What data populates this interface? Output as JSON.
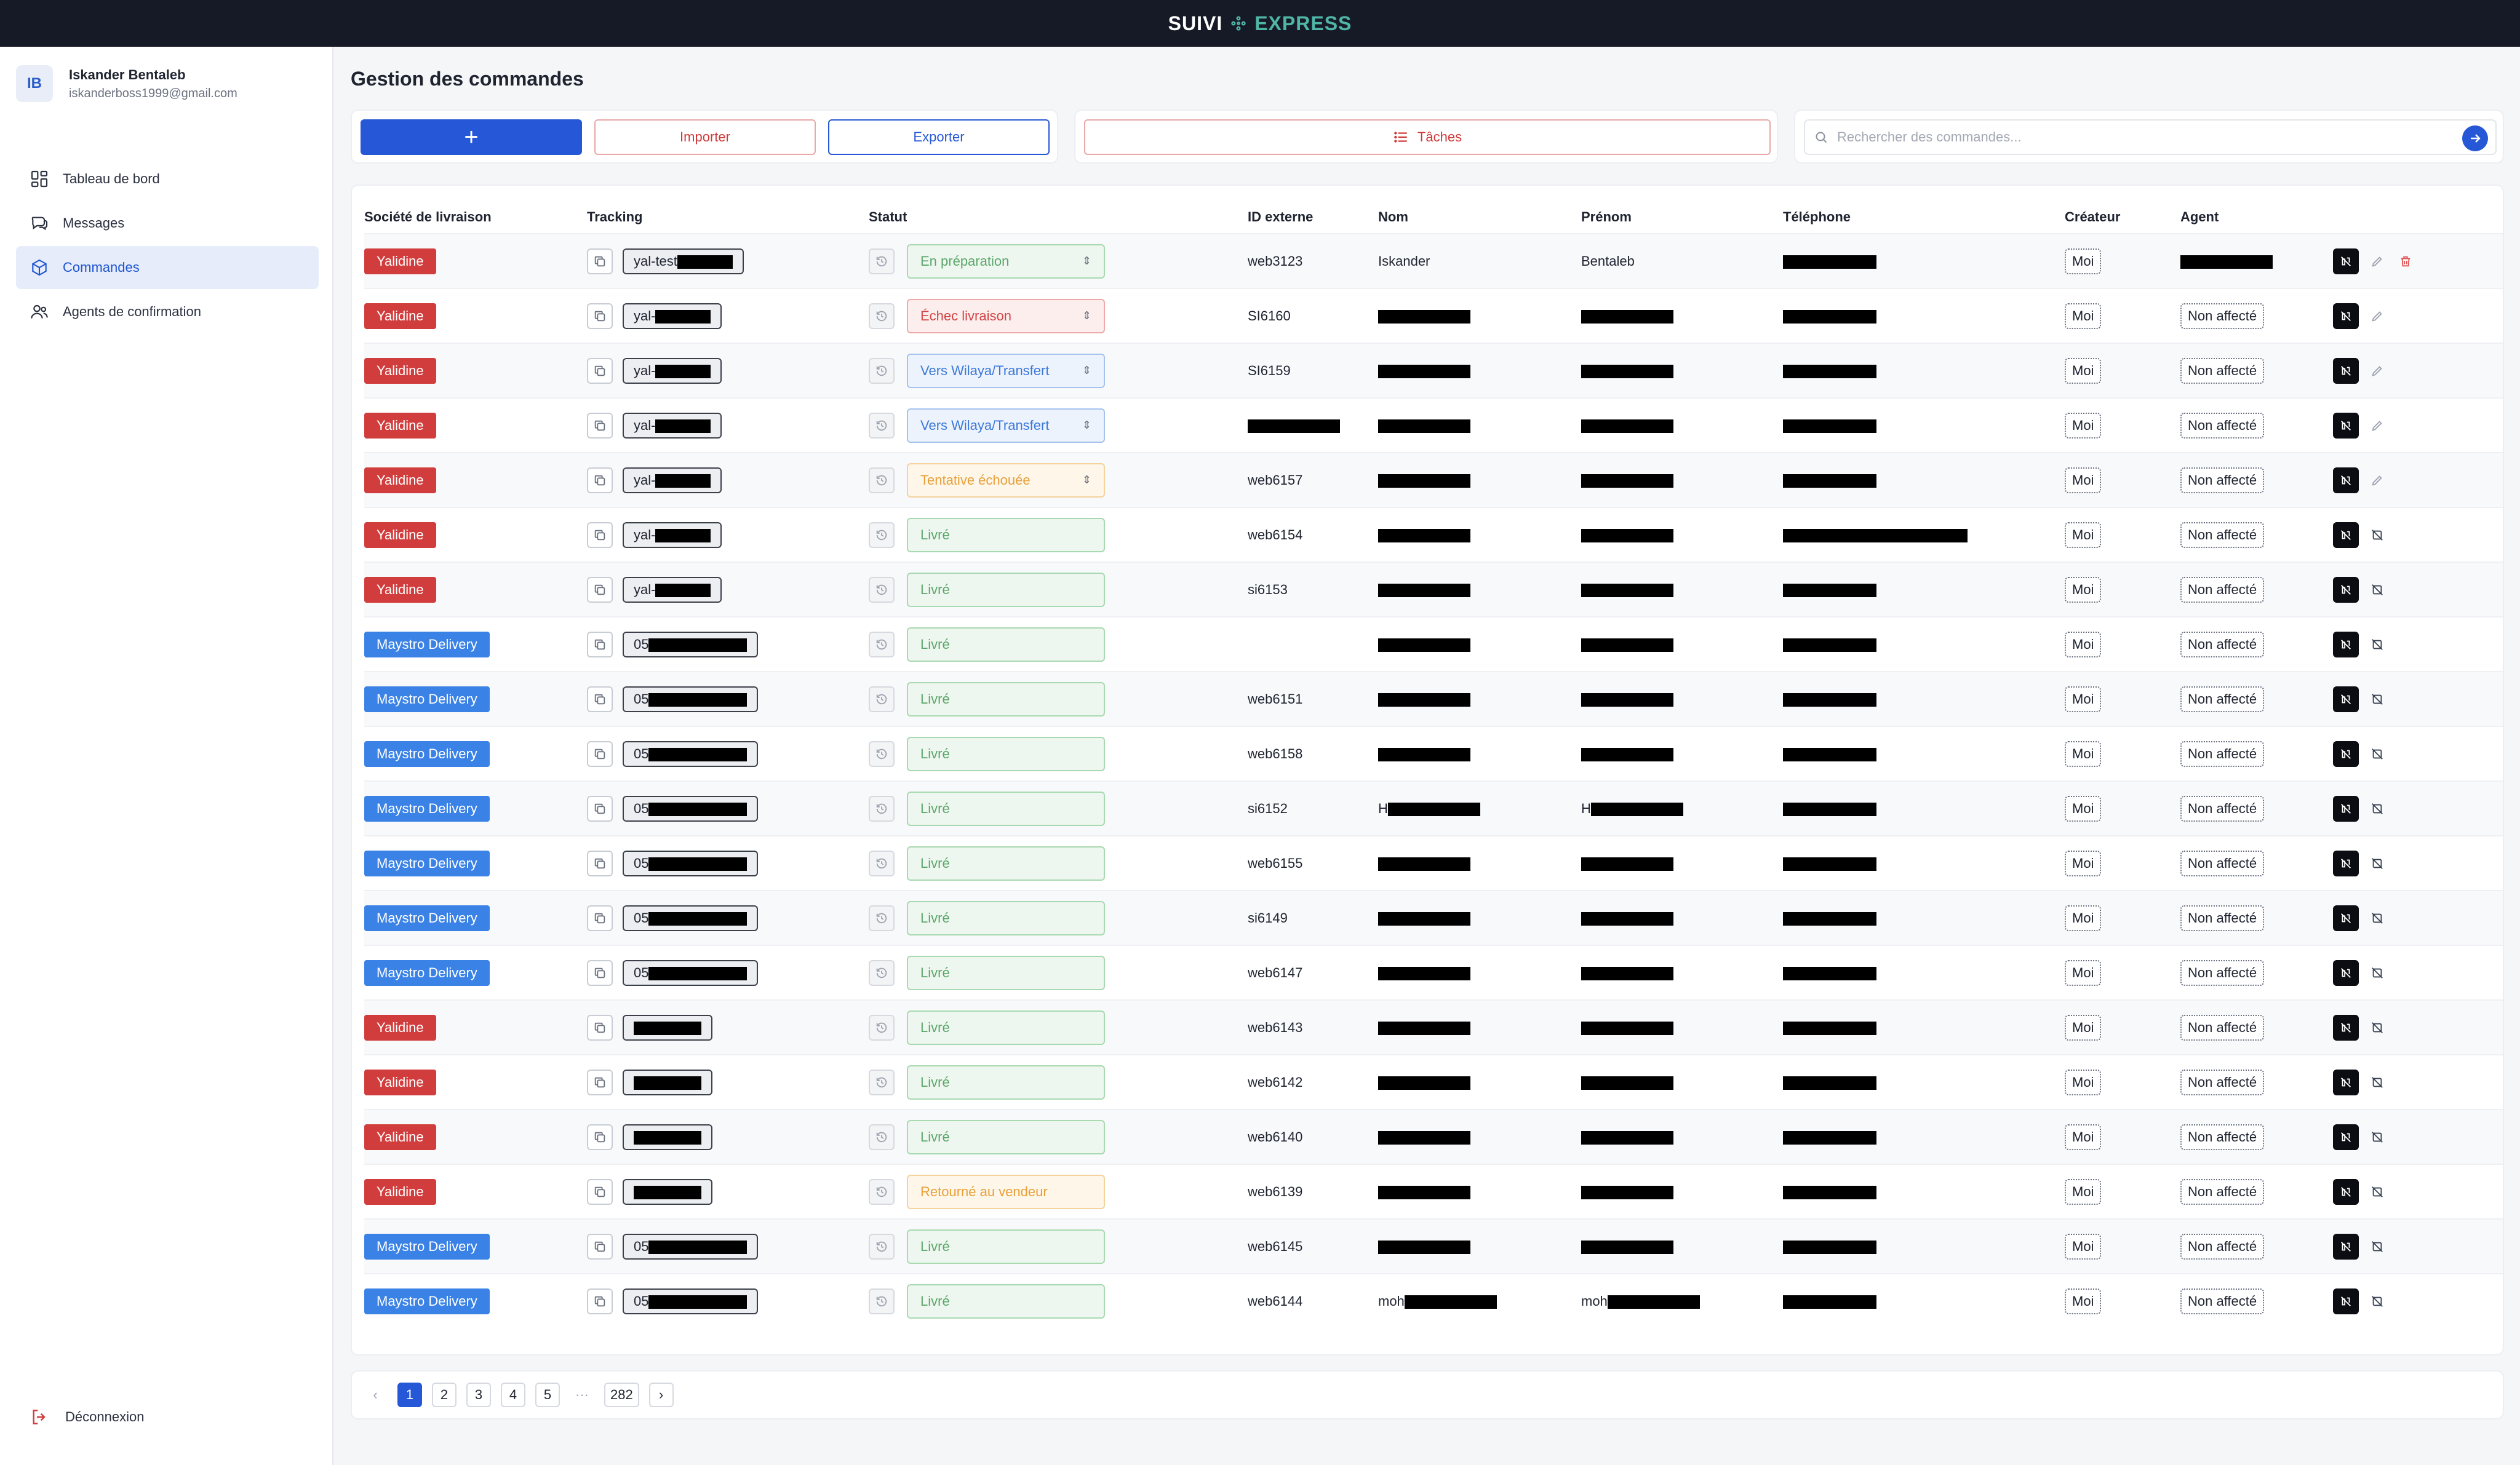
{
  "brand": {
    "part1": "SUIVI",
    "part2": "EXPRESS"
  },
  "user": {
    "initials": "IB",
    "name": "Iskander Bentaleb",
    "email": "iskanderboss1999@gmail.com"
  },
  "nav": [
    {
      "label": "Tableau de bord",
      "icon": "dashboard-icon",
      "active": false
    },
    {
      "label": "Messages",
      "icon": "messages-icon",
      "active": false
    },
    {
      "label": "Commandes",
      "icon": "box-icon",
      "active": true
    },
    {
      "label": "Agents de confirmation",
      "icon": "users-icon",
      "active": false
    }
  ],
  "logout_label": "Déconnexion",
  "page_title": "Gestion des commandes",
  "toolbar": {
    "add_label": "+",
    "import_label": "Importer",
    "export_label": "Exporter",
    "tasks_label": "Tâches",
    "search_placeholder": "Rechercher des commandes..."
  },
  "columns": [
    "Société de livraison",
    "Tracking",
    "Statut",
    "ID externe",
    "Nom",
    "Prénom",
    "Téléphone",
    "Créateur",
    "Agent"
  ],
  "rows": [
    {
      "company": "Yalidine",
      "tracking": "yal-test",
      "status": "En préparation",
      "status_tone": "green",
      "ext_id": "web3123",
      "nom": "Iskander",
      "prenom": "Bentaleb",
      "creator": "Moi",
      "agent": "",
      "actions": "edit-delete"
    },
    {
      "company": "Yalidine",
      "tracking": "yal-",
      "status": "Échec livraison",
      "status_tone": "red",
      "ext_id": "SI6160",
      "nom": "",
      "prenom": "",
      "creator": "Moi",
      "agent": "Non affecté",
      "actions": "edit"
    },
    {
      "company": "Yalidine",
      "tracking": "yal-",
      "status": "Vers Wilaya/Transfert",
      "status_tone": "blue",
      "ext_id": "SI6159",
      "nom": "",
      "prenom": "",
      "creator": "Moi",
      "agent": "Non affecté",
      "actions": "edit"
    },
    {
      "company": "Yalidine",
      "tracking": "yal-",
      "status": "Vers Wilaya/Transfert",
      "status_tone": "blue",
      "ext_id": "",
      "nom": "",
      "prenom": "",
      "creator": "Moi",
      "agent": "Non affecté",
      "actions": "edit"
    },
    {
      "company": "Yalidine",
      "tracking": "yal-",
      "status": "Tentative échouée",
      "status_tone": "orange",
      "ext_id": "web6157",
      "nom": "",
      "prenom": "",
      "creator": "Moi",
      "agent": "Non affecté",
      "actions": "edit"
    },
    {
      "company": "Yalidine",
      "tracking": "yal-",
      "status": "Livré",
      "status_tone": "green",
      "ext_id": "web6154",
      "nom": "",
      "prenom": "",
      "creator": "Moi",
      "agent": "Non affecté",
      "actions": "cancel"
    },
    {
      "company": "Yalidine",
      "tracking": "yal-",
      "status": "Livré",
      "status_tone": "green",
      "ext_id": "si6153",
      "nom": "",
      "prenom": "",
      "creator": "Moi",
      "agent": "Non affecté",
      "actions": "cancel"
    },
    {
      "company": "Maystro Delivery",
      "tracking": "05",
      "status": "Livré",
      "status_tone": "green",
      "ext_id": "",
      "nom": "",
      "prenom": "",
      "creator": "Moi",
      "agent": "Non affecté",
      "actions": "cancel"
    },
    {
      "company": "Maystro Delivery",
      "tracking": "05",
      "status": "Livré",
      "status_tone": "green",
      "ext_id": "web6151",
      "nom": "",
      "prenom": "",
      "creator": "Moi",
      "agent": "Non affecté",
      "actions": "cancel"
    },
    {
      "company": "Maystro Delivery",
      "tracking": "05",
      "status": "Livré",
      "status_tone": "green",
      "ext_id": "web6158",
      "nom": "",
      "prenom": "",
      "creator": "Moi",
      "agent": "Non affecté",
      "actions": "cancel"
    },
    {
      "company": "Maystro Delivery",
      "tracking": "05",
      "status": "Livré",
      "status_tone": "green",
      "ext_id": "si6152",
      "nom": "H",
      "prenom": "H",
      "creator": "Moi",
      "agent": "Non affecté",
      "actions": "cancel"
    },
    {
      "company": "Maystro Delivery",
      "tracking": "05",
      "status": "Livré",
      "status_tone": "green",
      "ext_id": "web6155",
      "nom": "",
      "prenom": "",
      "creator": "Moi",
      "agent": "Non affecté",
      "actions": "cancel"
    },
    {
      "company": "Maystro Delivery",
      "tracking": "05",
      "status": "Livré",
      "status_tone": "green",
      "ext_id": "si6149",
      "nom": "",
      "prenom": "",
      "creator": "Moi",
      "agent": "Non affecté",
      "actions": "cancel"
    },
    {
      "company": "Maystro Delivery",
      "tracking": "05",
      "status": "Livré",
      "status_tone": "green",
      "ext_id": "web6147",
      "nom": "",
      "prenom": "",
      "creator": "Moi",
      "agent": "Non affecté",
      "actions": "cancel"
    },
    {
      "company": "Yalidine",
      "tracking": "",
      "status": "Livré",
      "status_tone": "green",
      "ext_id": "web6143",
      "nom": "",
      "prenom": "",
      "creator": "Moi",
      "agent": "Non affecté",
      "actions": "cancel"
    },
    {
      "company": "Yalidine",
      "tracking": "",
      "status": "Livré",
      "status_tone": "green",
      "ext_id": "web6142",
      "nom": "",
      "prenom": "",
      "creator": "Moi",
      "agent": "Non affecté",
      "actions": "cancel"
    },
    {
      "company": "Yalidine",
      "tracking": "",
      "status": "Livré",
      "status_tone": "green",
      "ext_id": "web6140",
      "nom": "",
      "prenom": "",
      "creator": "Moi",
      "agent": "Non affecté",
      "actions": "cancel"
    },
    {
      "company": "Yalidine",
      "tracking": "",
      "status": "Retourné au vendeur",
      "status_tone": "orange",
      "ext_id": "web6139",
      "nom": "",
      "prenom": "",
      "creator": "Moi",
      "agent": "Non affecté",
      "actions": "cancel"
    },
    {
      "company": "Maystro Delivery",
      "tracking": "05",
      "status": "Livré",
      "status_tone": "green",
      "ext_id": "web6145",
      "nom": "",
      "prenom": "",
      "creator": "Moi",
      "agent": "Non affecté",
      "actions": "cancel"
    },
    {
      "company": "Maystro Delivery",
      "tracking": "05",
      "status": "Livré",
      "status_tone": "green",
      "ext_id": "web6144",
      "nom": "moh",
      "prenom": "moh",
      "creator": "Moi",
      "agent": "Non affecté",
      "actions": "cancel"
    }
  ],
  "pagination": {
    "prev": "‹",
    "pages": [
      "1",
      "2",
      "3",
      "4",
      "5"
    ],
    "current": "1",
    "ellipsis": "···",
    "last": "282",
    "next": "›"
  },
  "colors": {
    "accent": "#2557d6",
    "yalidine": "#d13c3c",
    "maystro": "#3b82e6",
    "topbar": "#161a26"
  }
}
